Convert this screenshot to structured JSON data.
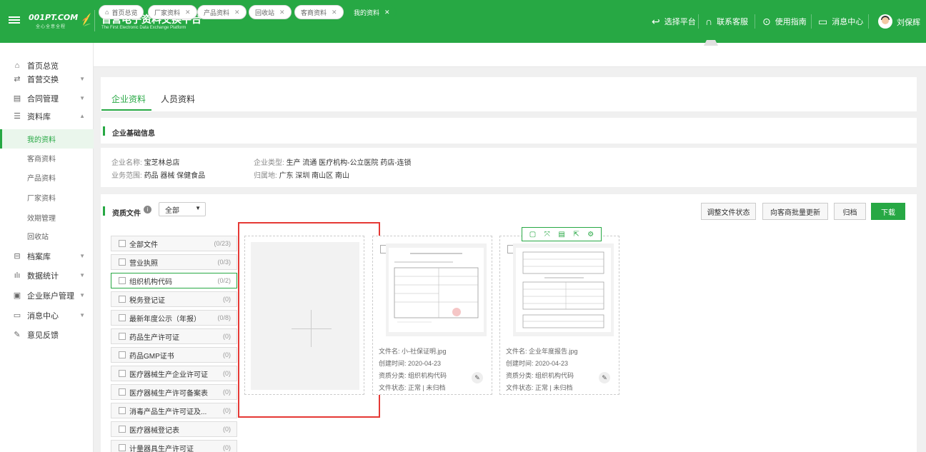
{
  "header": {
    "logo_text": "001PT.COM",
    "logo_sub": "全心全意全程",
    "title": "首营电子资料交换平台",
    "subtitle": "The First Electronic Data Exchange Platform",
    "nav": {
      "select_platform": "选择平台",
      "contact": "联系客服",
      "guide": "使用指南",
      "messages": "消息中心"
    },
    "user_name": "刘保辉",
    "accent_color": "#27a844"
  },
  "sidebar": {
    "items": [
      {
        "label": "首页总览",
        "icon": "home-icon"
      },
      {
        "label": "首营交换",
        "icon": "exchange-icon"
      },
      {
        "label": "合同管理",
        "icon": "contract-icon"
      },
      {
        "label": "资料库",
        "icon": "library-icon"
      },
      {
        "label": "档案库",
        "icon": "archive-icon"
      },
      {
        "label": "数据统计",
        "icon": "stats-icon"
      },
      {
        "label": "企业账户管理",
        "icon": "account-icon"
      },
      {
        "label": "消息中心",
        "icon": "message-icon"
      },
      {
        "label": "意见反馈",
        "icon": "feedback-icon"
      }
    ],
    "sub_items": [
      "我的资料",
      "客商资料",
      "产品资料",
      "厂家资料",
      "效期管理",
      "回收站"
    ]
  },
  "tabs": [
    {
      "label": "首页总览",
      "closable": false
    },
    {
      "label": "厂家资料",
      "closable": true
    },
    {
      "label": "产品资料",
      "closable": true
    },
    {
      "label": "回收站",
      "closable": true
    },
    {
      "label": "客商资料",
      "closable": true
    },
    {
      "label": "我的资料",
      "closable": true,
      "active": true
    }
  ],
  "content_tabs": [
    "企业资料",
    "人员资料"
  ],
  "basic_info": {
    "section_title": "企业基础信息",
    "name_label": "企业名称:",
    "name_value": "宝芝林总店",
    "scope_label": "业务范围:",
    "scope_value": "药品 器械 保健食品",
    "type_label": "企业类型:",
    "type_value": "生产 流通 医疗机构-公立医院 药店-连锁",
    "location_label": "归属地:",
    "location_value": "广东 深圳 南山区 南山"
  },
  "qualification": {
    "section_title": "资质文件",
    "filter_value": "全部",
    "buttons": {
      "adjust_status": "调整文件状态",
      "batch_update": "向客商批量更新",
      "archive": "归档",
      "download": "下载"
    },
    "categories": [
      {
        "name": "全部文件",
        "count": "(0/23)"
      },
      {
        "name": "营业执照",
        "count": "(0/3)"
      },
      {
        "name": "组织机构代码",
        "count": "(0/2)"
      },
      {
        "name": "税务登记证",
        "count": "(0)"
      },
      {
        "name": "最新年度公示（年报）",
        "count": "(0/8)"
      },
      {
        "name": "药品生产许可证",
        "count": "(0)"
      },
      {
        "name": "药品GMP证书",
        "count": "(0)"
      },
      {
        "name": "医疗器械生产企业许可证",
        "count": "(0)"
      },
      {
        "name": "医疗器械生产许可备案表",
        "count": "(0)"
      },
      {
        "name": "消毒产品生产许可证及...",
        "count": "(0)"
      },
      {
        "name": "医疗器械登记表",
        "count": "(0)"
      },
      {
        "name": "计量器具生产许可证",
        "count": "(0)"
      }
    ],
    "files": [
      {
        "name": "文件名: 小-社保证明.jpg",
        "created": "创建时间: 2020-04-23",
        "category": "资质分类: 组织机构代码",
        "status": "文件状态: 正常 | 未归档"
      },
      {
        "name": "文件名: 企业年度报告.jpg",
        "created": "创建时间: 2020-04-23",
        "category": "资质分类: 组织机构代码",
        "status": "文件状态: 正常 | 未归档"
      }
    ]
  }
}
